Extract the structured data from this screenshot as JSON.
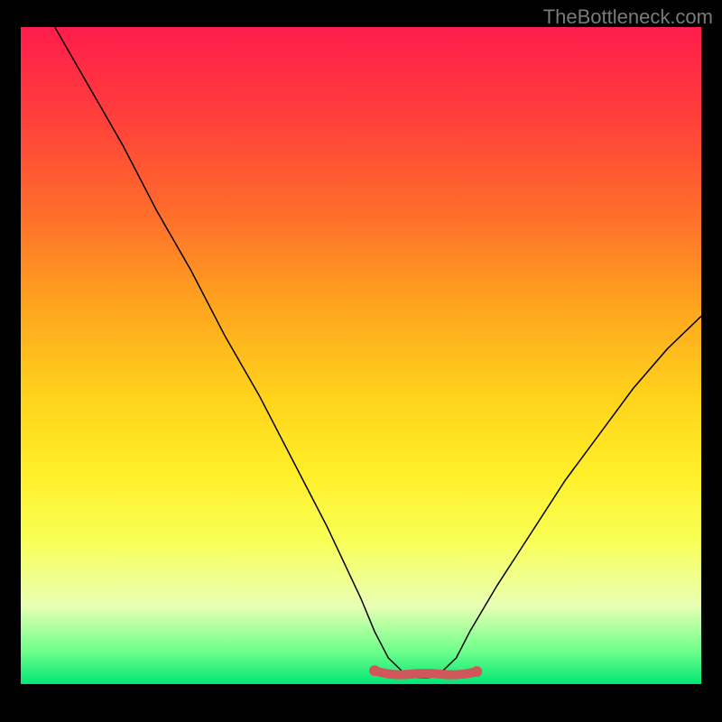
{
  "watermark": "TheBottleneck.com",
  "chart_data": {
    "type": "line",
    "title": "",
    "xlabel": "",
    "ylabel": "",
    "xlim": [
      0,
      100
    ],
    "ylim": [
      0,
      100
    ],
    "grid": false,
    "legend": false,
    "series": [
      {
        "name": "bottleneck-curve",
        "x": [
          5,
          10,
          15,
          20,
          25,
          30,
          35,
          40,
          45,
          50,
          52,
          54,
          56,
          58,
          60,
          62,
          64,
          66,
          70,
          75,
          80,
          85,
          90,
          95,
          100
        ],
        "y": [
          100,
          91,
          82,
          72,
          63,
          53,
          44,
          34,
          24,
          13,
          8,
          4,
          2,
          1,
          1,
          2,
          4,
          8,
          15,
          23,
          31,
          38,
          45,
          51,
          56
        ]
      }
    ],
    "highlight": {
      "name": "optimal-range",
      "x_start": 52,
      "x_end": 67,
      "y": 1.5
    }
  }
}
